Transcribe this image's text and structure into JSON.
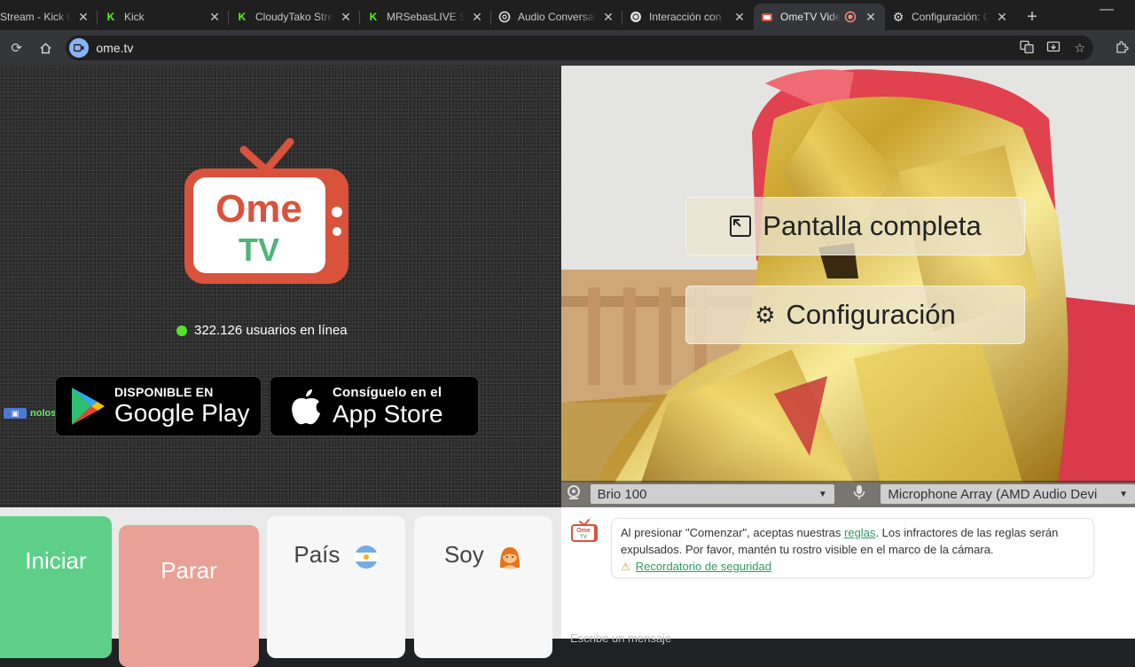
{
  "tabs": [
    {
      "title": "Stream - Kick Da",
      "icon": "kick-icon",
      "active": false
    },
    {
      "title": "Kick",
      "icon": "kick-icon",
      "active": false
    },
    {
      "title": "CloudyTako Strea",
      "icon": "kick-icon",
      "active": false
    },
    {
      "title": "MRSebasLIVE St",
      "icon": "kick-icon",
      "active": false
    },
    {
      "title": "Audio Conversat",
      "icon": "openai-icon",
      "active": false
    },
    {
      "title": "Interacción con",
      "icon": "openai-icon",
      "active": false
    },
    {
      "title": "OmeTV Vide",
      "icon": "ometv-icon",
      "active": true
    },
    {
      "title": "Configuración: C",
      "icon": "gear-icon",
      "active": false
    }
  ],
  "toolbar": {
    "url": "ome.tv"
  },
  "logo": {
    "line1": "Ome",
    "line2": "TV"
  },
  "online": {
    "text": "322.126 usuarios en línea"
  },
  "stores": {
    "google_small": "DISPONIBLE EN",
    "google_big": "Google Play",
    "apple_small": "Consíguelo en el",
    "apple_big": "App Store"
  },
  "stream_overlay": {
    "username": "nolosabi :"
  },
  "camera": {
    "fullscreen_label": "Pantalla completa",
    "settings_label": "Configuración",
    "camera_device": "Brio 100",
    "mic_device": "Microphone Array (AMD Audio Devi"
  },
  "controls": {
    "start_label": "Iniciar",
    "stop_label": "Parar",
    "country_label": "País",
    "gender_label": "Soy"
  },
  "chat": {
    "rules_before": "Al presionar \"Comenzar\", aceptas nuestras ",
    "rules_link": "reglas",
    "rules_after": ". Los infractores de las reglas serán expulsados. Por favor, mantén tu rostro visible en el marco de la cámara.",
    "safety_link": "Recordatorio de seguridad",
    "input_placeholder": "Escribe un mensaje"
  },
  "colors": {
    "brand_red": "#d9533c",
    "brand_green": "#4cb577",
    "online_dot": "#54e327",
    "start_green": "#5ecf89",
    "stop_red": "#e9a195"
  }
}
